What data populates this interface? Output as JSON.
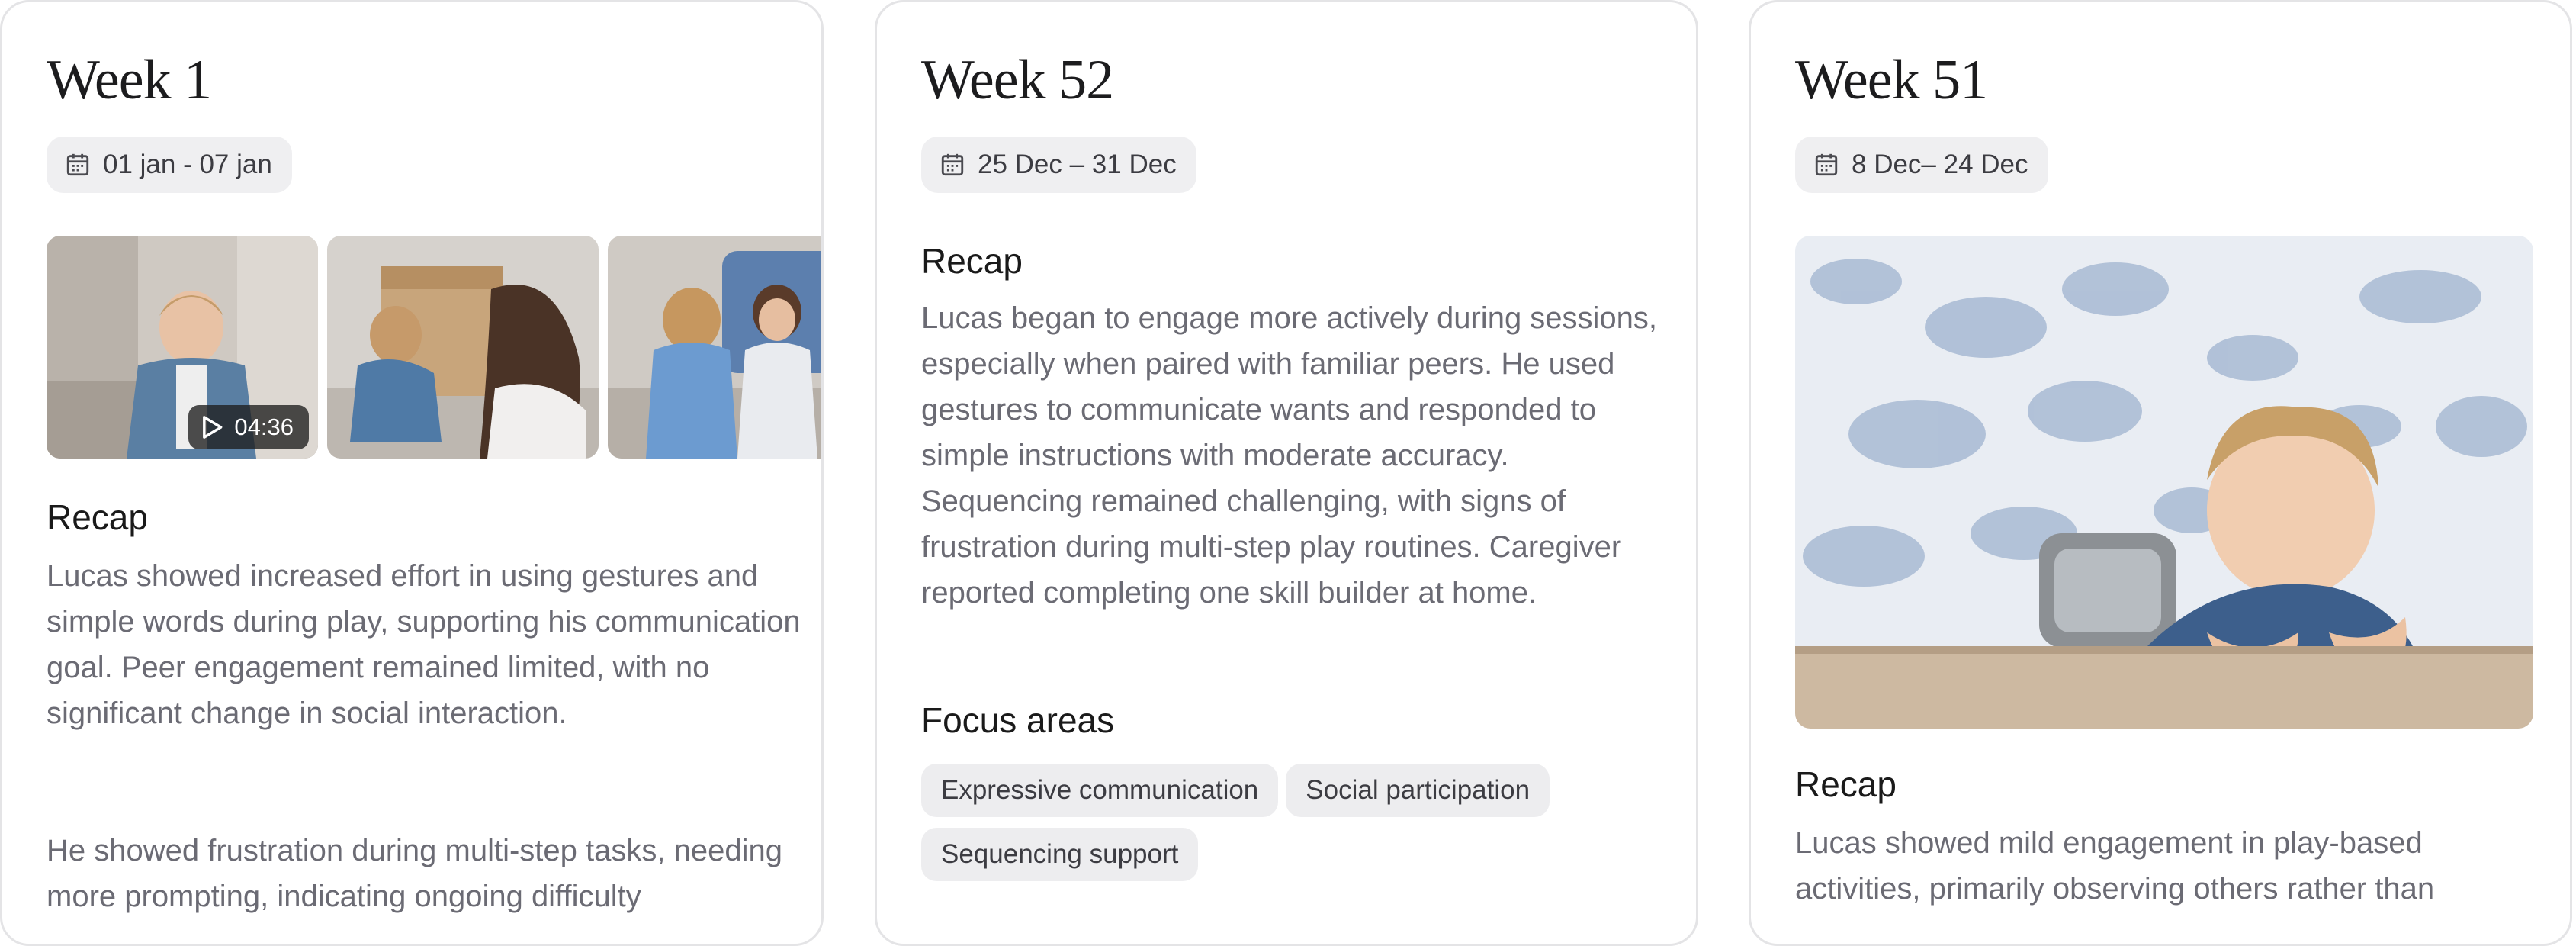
{
  "cards": [
    {
      "week": "Week 1",
      "date_range": "01 jan - 07 jan",
      "video_duration": "04:36",
      "recap_heading": "Recap",
      "recap_paragraphs": [
        "Lucas showed increased effort in using gestures and simple words during play, supporting his communication goal. Peer engagement remained limited, with no significant change in social interaction.",
        "He showed frustration during multi-step tasks, needing more prompting, indicating ongoing difficulty"
      ]
    },
    {
      "week": "Week 52",
      "date_range": "25 Dec – 31 Dec",
      "recap_heading": "Recap",
      "recap_text": "Lucas began to engage more actively during sessions, especially when paired with familiar peers. He used gestures to communicate wants and responded to simple instructions with moderate accuracy. Sequencing remained challenging, with signs of frustration during multi-step play routines. Caregiver reported completing one skill builder at home.",
      "focus_heading": "Focus areas",
      "focus_areas": [
        "Expressive communication",
        "Social participation",
        "Sequencing support"
      ]
    },
    {
      "week": "Week 51",
      "date_range": "8 Dec– 24 Dec",
      "recap_heading": "Recap",
      "recap_text": "Lucas showed mild engagement in play-based activities, primarily observing others rather than"
    }
  ],
  "icons": {
    "date": "calendar-icon",
    "video": "play-icon"
  },
  "colors": {
    "pill_bg": "#efeff1",
    "card_border": "#e4e4e6",
    "body_text": "#6b6b74"
  }
}
